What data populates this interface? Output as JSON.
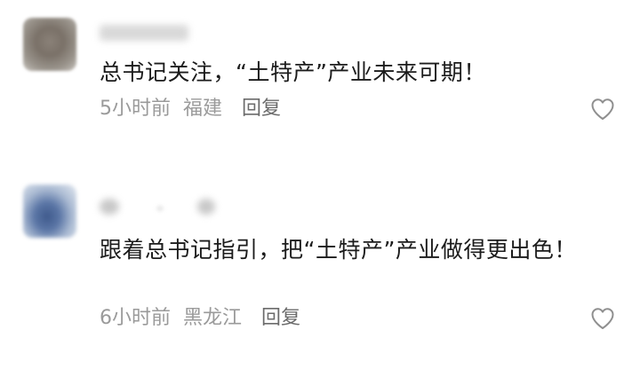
{
  "comments": [
    {
      "content": "总书记关注，“土特产”产业未来可期！",
      "time": "5小时前",
      "location": "福建",
      "reply_label": "回复",
      "like_icon": "heart-outline-icon"
    },
    {
      "content": "跟着总书记指引，把“土特产”产业做得更出色！",
      "time": "6小时前",
      "location": "黑龙江",
      "reply_label": "回复",
      "like_icon": "heart-outline-icon"
    }
  ],
  "colors": {
    "text": "#1b1b1b",
    "meta": "#9a9a9a",
    "reply": "#6b6b6b",
    "icon": "#8f8f8f"
  }
}
